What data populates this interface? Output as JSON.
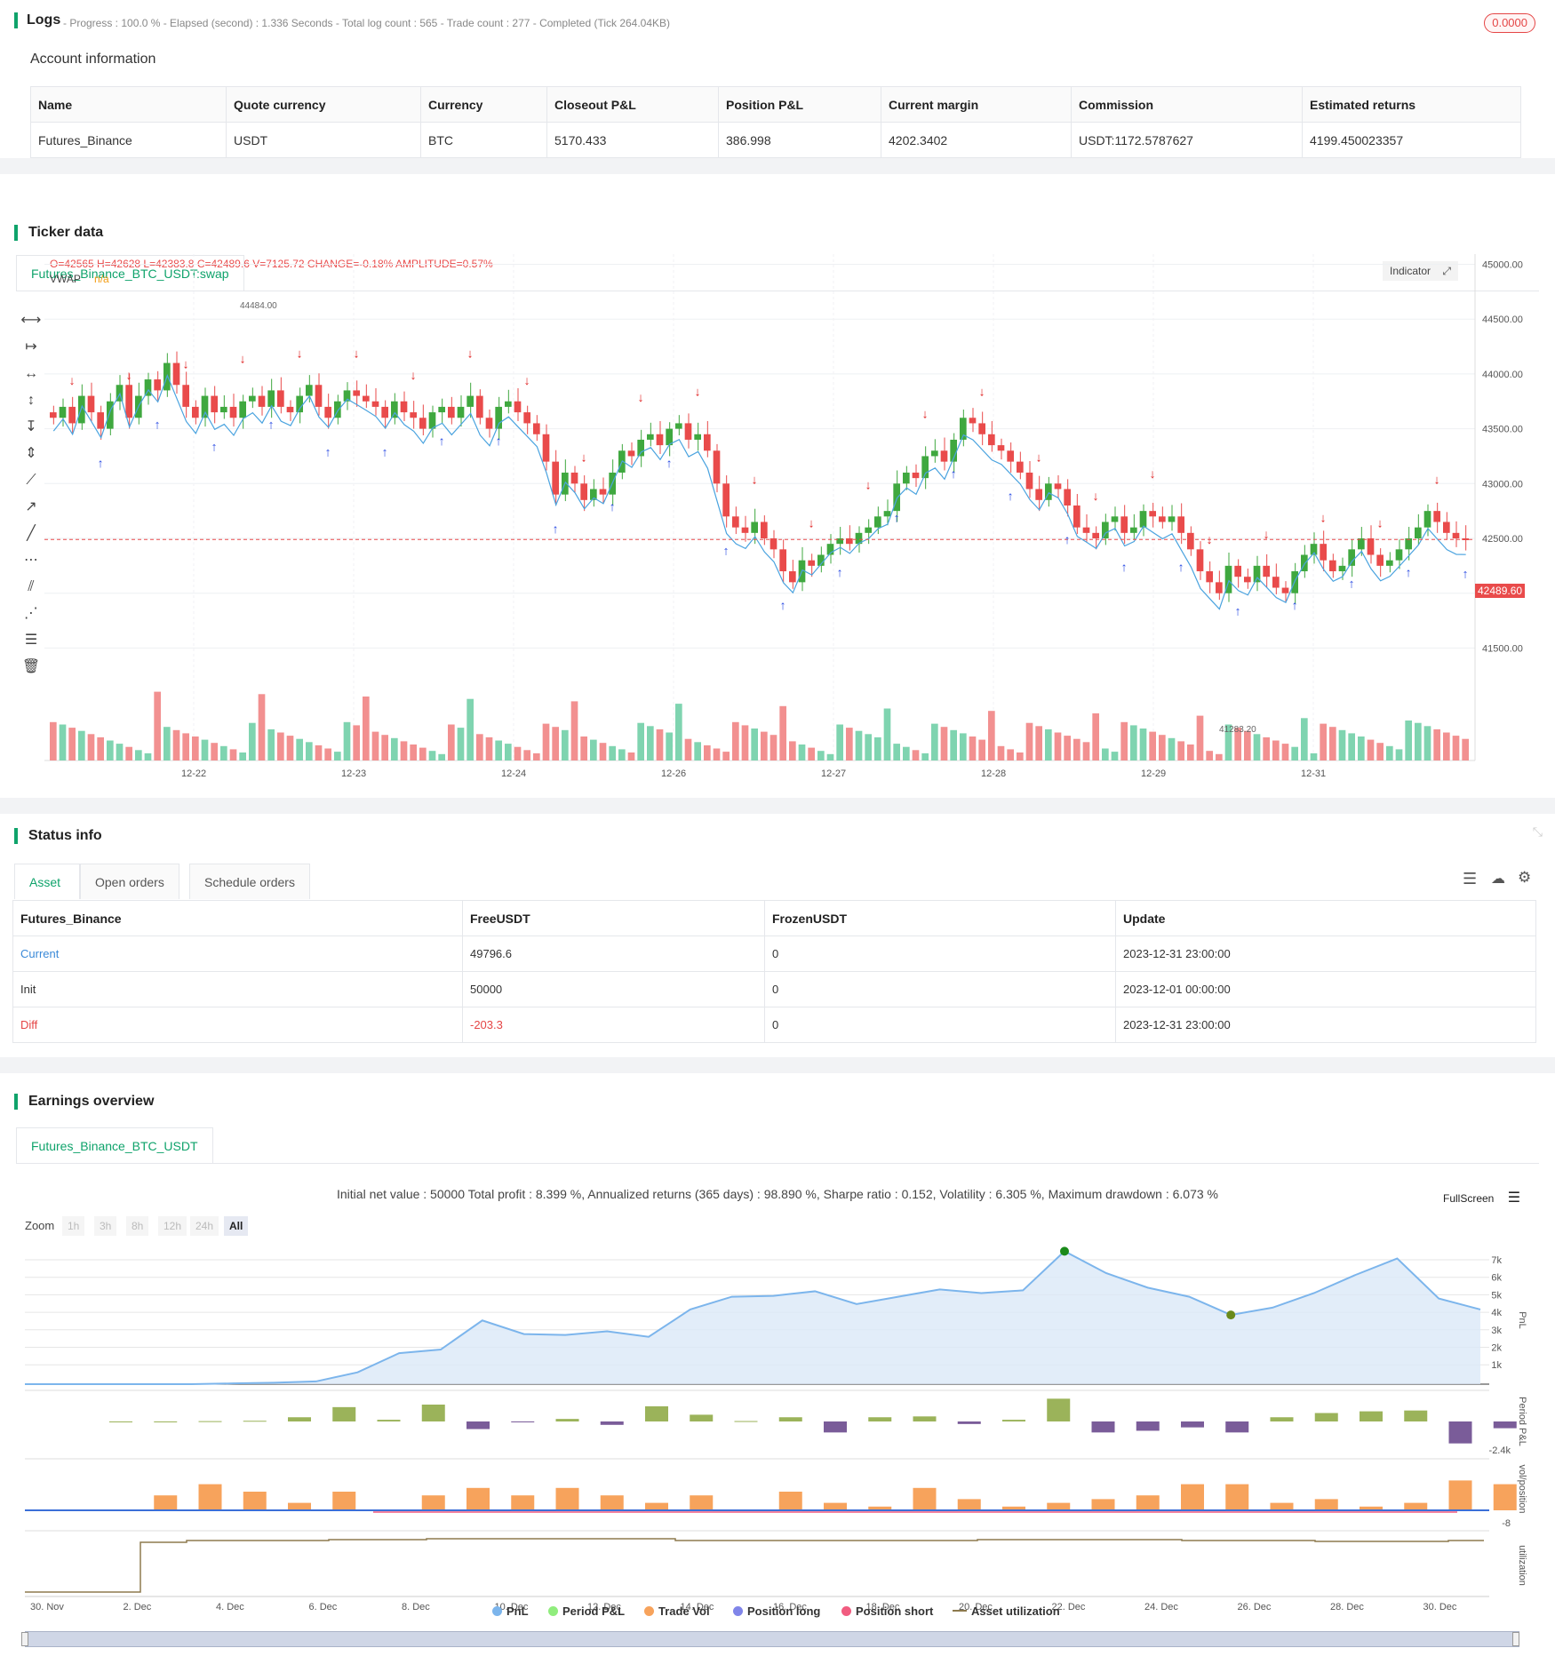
{
  "logs": {
    "title": "Logs",
    "status": "- Progress : 100.0 % - Elapsed (second) : 1.336  Seconds - Total log count : 565 - Trade count : 277 - Completed (Tick 264.04KB)",
    "badge": "0.0000"
  },
  "account": {
    "heading": "Account information",
    "columns": [
      "Name",
      "Quote currency",
      "Currency",
      "Closeout P&L",
      "Position P&L",
      "Current margin",
      "Commission",
      "Estimated returns"
    ],
    "row": [
      "Futures_Binance",
      "USDT",
      "BTC",
      "5170.433",
      "386.998",
      "4202.3402",
      "USDT:1172.5787627",
      "4199.450023357"
    ]
  },
  "ticker": {
    "heading": "Ticker data",
    "tab": "Futures_Binance_BTC_USDT:swap",
    "ohlc": "O=42565 H=42628 L=42383.8 C=42489.6 V=7125.72 CHANGE=-0.18% AMPLITUDE=0.57%",
    "vwap_label": "VWAP",
    "vwap_value": "n/a",
    "indicator_btn": "Indicator",
    "last_price": "42489.60",
    "high_mark": "44484.00",
    "low_mark": "41283.20",
    "y_ticks": [
      "45000.00",
      "44500.00",
      "44000.00",
      "43500.00",
      "43000.00",
      "42500.00",
      "42000.00",
      "41500.00"
    ],
    "x_ticks": [
      "12-22",
      "12-23",
      "12-24",
      "12-26",
      "12-27",
      "12-28",
      "12-29",
      "12-31"
    ],
    "colors": {
      "up": "#3fa83f",
      "down": "#e94b4b",
      "vwap": "#4aa3df",
      "signal_long": "#2b4ce3",
      "signal_short": "#e02424",
      "close": "#c020e0"
    }
  },
  "status": {
    "heading": "Status info",
    "tabs": [
      "Asset",
      "Open orders",
      "Schedule orders"
    ],
    "columns": [
      "Futures_Binance",
      "FreeUSDT",
      "FrozenUSDT",
      "Update"
    ],
    "rows": [
      [
        "Current",
        "49796.6",
        "0",
        "2023-12-31 23:00:00"
      ],
      [
        "Init",
        "50000",
        "0",
        "2023-12-01 00:00:00"
      ],
      [
        "Diff",
        "-203.3",
        "0",
        "2023-12-31 23:00:00"
      ]
    ]
  },
  "earnings": {
    "heading": "Earnings overview",
    "tab": "Futures_Binance_BTC_USDT",
    "summary": "Initial net value : 50000 Total profit : 8.399 %, Annualized returns (365 days) : 98.890 %, Sharpe ratio : 0.152, Volatility : 6.305 %, Maximum drawdown : 6.073 %",
    "fullscreen": "FullScreen",
    "zoom_label": "Zoom",
    "zoom_options": [
      "1h",
      "3h",
      "8h",
      "12h",
      "24h",
      "All"
    ],
    "pnl_ticks": [
      "7k",
      "6k",
      "5k",
      "4k",
      "3k",
      "2k",
      "1k"
    ],
    "axis_titles": [
      "PnL",
      "Period P&L",
      "vol/position",
      "utilization"
    ],
    "period_min_label": "-2.4k",
    "vol_min_label": "-8",
    "x_ticks": [
      "30. Nov",
      "2. Dec",
      "4. Dec",
      "6. Dec",
      "8. Dec",
      "10. Dec",
      "12. Dec",
      "14. Dec",
      "16. Dec",
      "18. Dec",
      "20. Dec",
      "22. Dec",
      "24. Dec",
      "26. Dec",
      "28. Dec",
      "30. Dec"
    ],
    "legend": [
      "PnL",
      "Period P&L",
      "Trade Vol",
      "Position long",
      "Position short",
      "Asset utilization"
    ],
    "legend_colors": [
      "#7cb5ec",
      "#90ed7d",
      "#f7a35c",
      "#8085e9",
      "#f15c80",
      "#8d7a4e"
    ],
    "chart_data": {
      "type": "line",
      "pnl": [
        0,
        0,
        0,
        0,
        0,
        40,
        80,
        150,
        650,
        1700,
        1900,
        3500,
        2750,
        2700,
        2900,
        2600,
        4100,
        4800,
        4850,
        5100,
        4400,
        4800,
        5200,
        5000,
        5150,
        7300,
        6100,
        5300,
        4800,
        3800,
        4200,
        5000,
        6000,
        6900,
        4700,
        4100
      ],
      "period_pnl": [
        0,
        0,
        40,
        80,
        500,
        1700,
        200,
        2000,
        -900,
        -100,
        300,
        -400,
        1800,
        800,
        50,
        500,
        -1300,
        500,
        600,
        -300,
        200,
        2700,
        -1300,
        -1100,
        -700,
        -1300,
        500,
        1000,
        1200,
        1300,
        -2600,
        -800
      ],
      "trade_vol": [
        0,
        4,
        7,
        5,
        2,
        5,
        0,
        4,
        6,
        4,
        6,
        4,
        2,
        4,
        0,
        5,
        2,
        1,
        6,
        3,
        1,
        2,
        3,
        4,
        7,
        7,
        2,
        3,
        1,
        2,
        8,
        7
      ],
      "utilization_note": "step"
    }
  }
}
